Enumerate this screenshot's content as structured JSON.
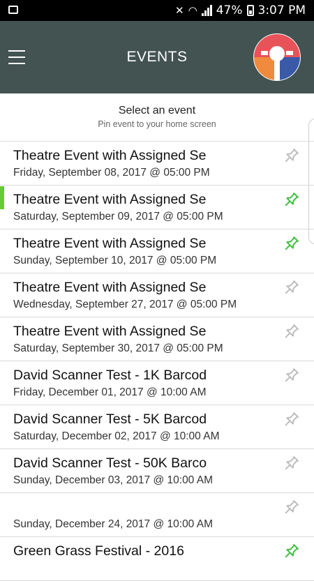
{
  "status_bar": {
    "battery_percent": "47%",
    "time": "3:07 PM"
  },
  "app_bar": {
    "title": "EVENTS",
    "menu_icon": "hamburger-menu-icon",
    "logo": "brand-logo"
  },
  "subheader": {
    "heading": "Select an event",
    "subtext": "Pin event to your home screen"
  },
  "colors": {
    "appbar": "#435351",
    "pin_active": "#3fbf3f",
    "pin_inactive": "#bdbdbd",
    "accent": "#66cc33"
  },
  "events": [
    {
      "name": "Theatre Event with Assigned Se",
      "date": "Friday, September 08, 2017 @ 05:00 PM",
      "pinned": false,
      "selected": false
    },
    {
      "name": "Theatre Event with Assigned Se",
      "date": "Saturday, September 09, 2017 @ 05:00 PM",
      "pinned": true,
      "selected": true
    },
    {
      "name": "Theatre Event with Assigned Se",
      "date": "Sunday, September 10, 2017 @ 05:00 PM",
      "pinned": true,
      "selected": false
    },
    {
      "name": "Theatre Event with Assigned Se",
      "date": "Wednesday, September 27, 2017 @ 05:00 PM",
      "pinned": false,
      "selected": false
    },
    {
      "name": "Theatre Event with Assigned Se",
      "date": "Saturday, September 30, 2017 @ 05:00 PM",
      "pinned": false,
      "selected": false
    },
    {
      "name": "David Scanner Test - 1K Barcod",
      "date": "Friday, December 01, 2017 @ 10:00 AM",
      "pinned": false,
      "selected": false
    },
    {
      "name": "David Scanner Test - 5K Barcod",
      "date": "Saturday, December 02, 2017 @ 10:00 AM",
      "pinned": false,
      "selected": false
    },
    {
      "name": "David Scanner Test - 50K Barco",
      "date": "Sunday, December 03, 2017 @ 10:00 AM",
      "pinned": false,
      "selected": false
    },
    {
      "name": "",
      "date": "Sunday, December 24, 2017 @ 10:00 AM",
      "pinned": false,
      "selected": false
    },
    {
      "name": "Green Grass Festival - 2016",
      "date": "",
      "pinned": true,
      "selected": false
    }
  ]
}
